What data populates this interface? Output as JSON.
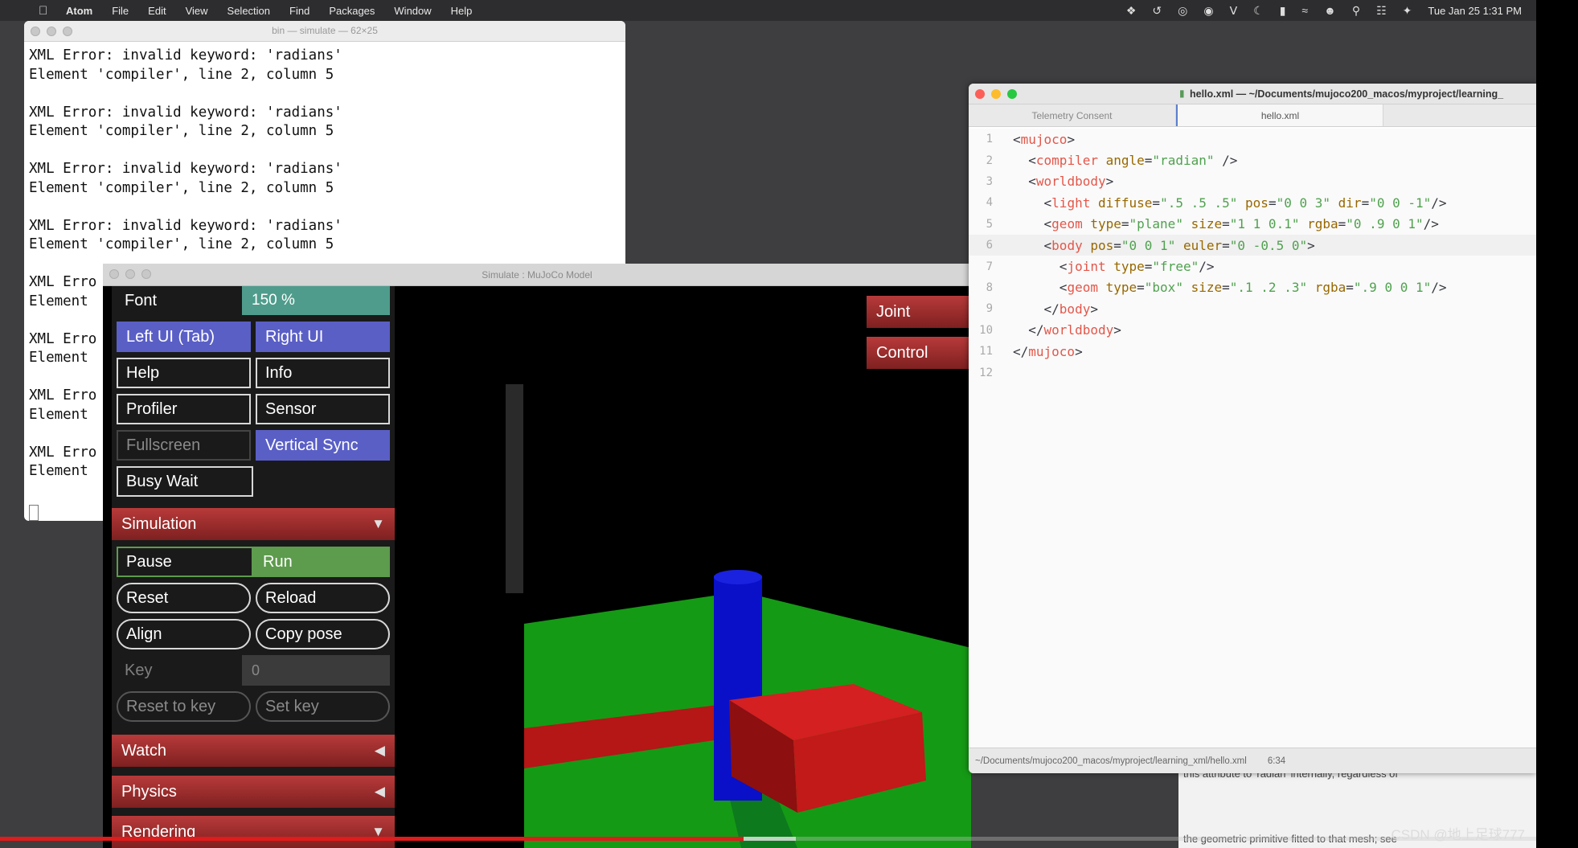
{
  "menubar": {
    "app": "Atom",
    "items": [
      "File",
      "Edit",
      "View",
      "Selection",
      "Find",
      "Packages",
      "Window",
      "Help"
    ],
    "clock": "Tue Jan 25  1:31 PM"
  },
  "terminal": {
    "title": "bin — simulate — 62×25",
    "lines": [
      "XML Error: invalid keyword: 'radians'",
      "Element 'compiler', line 2, column 5",
      "",
      "XML Error: invalid keyword: 'radians'",
      "Element 'compiler', line 2, column 5",
      "",
      "XML Error: invalid keyword: 'radians'",
      "Element 'compiler', line 2, column 5",
      "",
      "XML Error: invalid keyword: 'radians'",
      "Element 'compiler', line 2, column 5",
      "",
      "XML Erro",
      "Element",
      "",
      "XML Erro",
      "Element",
      "",
      "XML Erro",
      "Element",
      "",
      "XML Erro",
      "Element"
    ]
  },
  "simulate": {
    "title": "Simulate : MuJoCo Model",
    "font_label": "Font",
    "font_value": "150 %",
    "left_ui": "Left UI (Tab)",
    "right_ui": "Right UI",
    "help": "Help",
    "info": "Info",
    "profiler": "Profiler",
    "sensor": "Sensor",
    "fullscreen": "Fullscreen",
    "vertical_sync": "Vertical Sync",
    "busy_wait": "Busy Wait",
    "simulation": "Simulation",
    "pause": "Pause",
    "run": "Run",
    "reset": "Reset",
    "reload": "Reload",
    "align": "Align",
    "copy_pose": "Copy pose",
    "key_label": "Key",
    "key_value": "0",
    "reset_to_key": "Reset to key",
    "set_key": "Set key",
    "watch": "Watch",
    "physics": "Physics",
    "rendering": "Rendering",
    "joint": "Joint",
    "control": "Control",
    "colors": {
      "accent": "#5a5fc6",
      "section": "#a33030",
      "run": "#5d9b4d",
      "font_value": "#4f9c8c"
    }
  },
  "atom": {
    "title": "hello.xml — ~/Documents/mujoco200_macos/myproject/learning_",
    "tabs": [
      "Telemetry Consent",
      "hello.xml"
    ],
    "line_numbers": [
      "1",
      "2",
      "3",
      "4",
      "5",
      "6",
      "7",
      "8",
      "9",
      "10",
      "11",
      "12"
    ],
    "status_path": "~/Documents/mujoco200_macos/myproject/learning_xml/hello.xml",
    "status_pos": "6:34"
  },
  "behind_page": {
    "text1": "this attribute to 'radian' internally, regardless of",
    "text2": "the geometric primitive fitted to that mesh; see"
  },
  "watermark": "CSDN @地上足球777"
}
